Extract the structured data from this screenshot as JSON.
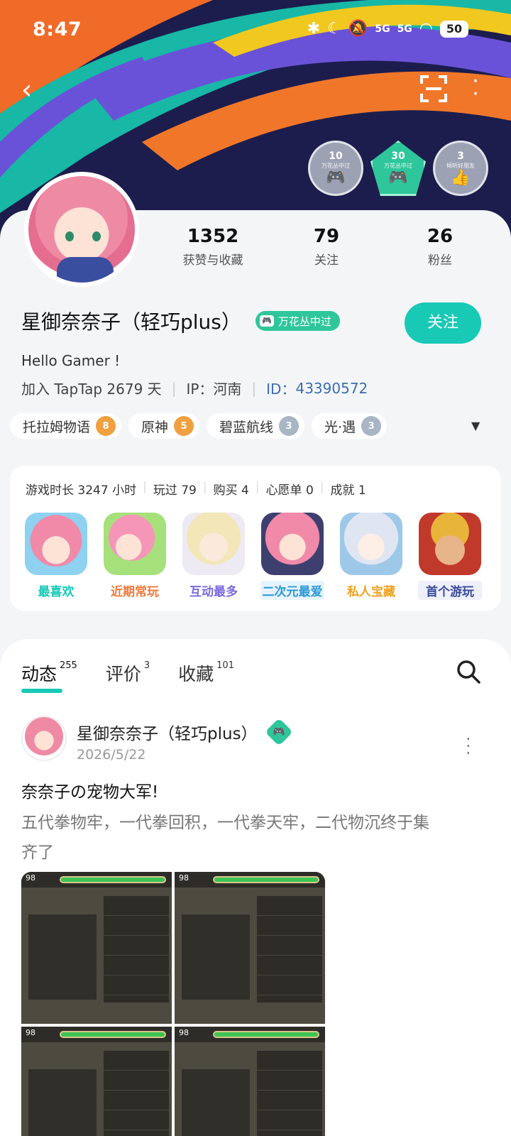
{
  "status": {
    "time": "8:47",
    "network1": "5G",
    "network2": "5G",
    "battery": "50"
  },
  "header": {
    "medals": [
      {
        "top": "10",
        "sub": "万花丛中过",
        "glyph": "🎮",
        "style": "gray"
      },
      {
        "top": "30",
        "sub": "万花丛中过",
        "glyph": "🎮",
        "style": "green"
      },
      {
        "top": "3",
        "sub": "倾听好朋友",
        "glyph": "👍",
        "style": "gray"
      }
    ]
  },
  "profile": {
    "stats": [
      {
        "value": "1352",
        "label": "获赞与收藏"
      },
      {
        "value": "79",
        "label": "关注"
      },
      {
        "value": "26",
        "label": "粉丝"
      }
    ],
    "name": "星御奈奈子（轻巧plus）",
    "badge": "万花丛中过",
    "follow_label": "关注",
    "bio": "Hello Gamer !",
    "joined": "加入 TapTap 2679 天",
    "ip": "IP：河南",
    "id_label": "ID：",
    "id_value": "43390572"
  },
  "tags": [
    {
      "name": "托拉姆物语",
      "level": "8",
      "color": "orange"
    },
    {
      "name": "原神",
      "level": "5",
      "color": "orange"
    },
    {
      "name": "碧蓝航线",
      "level": "3",
      "color": "gray"
    },
    {
      "name": "光·遇",
      "level": "3",
      "color": "gray"
    }
  ],
  "games_card": {
    "playtime": "游戏时长 3247 小时",
    "played": "玩过 79",
    "bought": "购买 4",
    "wishlist": "心愿单 0",
    "achievements": "成就 1",
    "games": [
      {
        "label": "最喜欢",
        "color": "#18c9b6",
        "bg": "#e8faf7"
      },
      {
        "label": "近期常玩",
        "color": "#f07a3a",
        "bg": "#fff1e8"
      },
      {
        "label": "互动最多",
        "color": "#7a6ae0",
        "bg": "#f1efff"
      },
      {
        "label": "二次元最爱",
        "color": "#2c9ad8",
        "bg": "#e8f4fd"
      },
      {
        "label": "私人宝藏",
        "color": "#f0a020",
        "bg": "#fff6e2"
      },
      {
        "label": "首个游玩",
        "color": "#3a4a9a",
        "bg": "#eef0fb"
      }
    ]
  },
  "tabs": [
    {
      "label": "动态",
      "count": "255"
    },
    {
      "label": "评价",
      "count": "3"
    },
    {
      "label": "收藏",
      "count": "101"
    }
  ],
  "post": {
    "author": "星御奈奈子（轻巧plus）",
    "date": "2026/5/22",
    "title": "奈奈子の宠物大军!",
    "body": "五代拳物牢，一代拳回积，一代拳天牢，二代物沉终于集齐了",
    "shot_level": "98"
  }
}
